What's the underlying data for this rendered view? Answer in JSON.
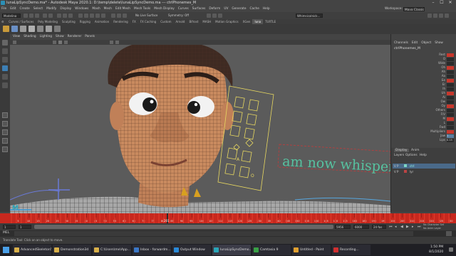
{
  "window": {
    "title": "lunaLipSyncDemo.ma* - Autodesk Maya 2020.1: D:\\temp\\delete\\lunaLipSyncDemo.ma --- ctrlPhonemes_M",
    "controls": [
      "–",
      "☐",
      "✕"
    ]
  },
  "menubar": {
    "items": [
      "File",
      "Edit",
      "Create",
      "Select",
      "Modify",
      "Display",
      "Windows",
      "Mash",
      "Mesh",
      "Edit Mesh",
      "Mesh Tools",
      "Mesh Display",
      "Curves",
      "Surfaces",
      "Deform",
      "UV",
      "Generate",
      "Cache",
      "Help"
    ],
    "workspace_label": "Workspace:",
    "workspace_value": "Maya Classic"
  },
  "statusline": {
    "mode": "Modeling",
    "no_live_surface": "No Live Surface",
    "symmetry": "Symmetry: Off",
    "user": "Whimsicalnick...",
    "sign_in": "v"
  },
  "shelf_tabs": [
    "Curves / Surfaces",
    "Poly Modeling",
    "Sculpting",
    "Rigging",
    "Animation",
    "Rendering",
    "FX",
    "FX Caching",
    "Custom",
    "Arnold",
    "Bifrost",
    "MASH",
    "Motion Graphics",
    "XGen",
    "luna",
    "TURTLE"
  ],
  "shelf_active_tab": "luna",
  "viewport_menu": [
    "View",
    "Shading",
    "Lighting",
    "Show",
    "Renderer",
    "Panels"
  ],
  "viewport": {
    "overlay_text": "am   now   whisper",
    "face_slider_labels": [
      "A",
      "O"
    ]
  },
  "channel_box": {
    "menu": [
      "Channels",
      "Edit",
      "Object",
      "Show"
    ],
    "object_name": "ctrlPhonemes_M",
    "channels": [
      "Rest",
      "O",
      "Wide",
      "Oh",
      "Ah",
      "Aa",
      "Ee",
      "Er",
      "Ih",
      "Uh",
      "Ai",
      "Ow",
      "Oy",
      "Others",
      "F/V",
      "M",
      "L",
      "Fwd",
      "Multipliers",
      "Jaw",
      "Lips"
    ],
    "multiplier_values": [
      "1",
      "0.15"
    ]
  },
  "layer_editor": {
    "menu": [
      "Display",
      "Anim"
    ],
    "submenu": [
      "Layers",
      "Options",
      "Help"
    ],
    "layers": [
      {
        "flags": "V P",
        "name": "ctrl"
      },
      {
        "flags": "V P",
        "name": "lyr"
      }
    ]
  },
  "timeline": {
    "current_frame": "201",
    "tick_labels": [
      "5",
      "10",
      "15",
      "20",
      "25",
      "30",
      "35",
      "40",
      "45",
      "50",
      "55",
      "60",
      "65",
      "70",
      "75",
      "80",
      "85",
      "90",
      "95",
      "100",
      "105",
      "110",
      "115",
      "120",
      "125",
      "130",
      "135",
      "140",
      "145",
      "150",
      "155",
      "160",
      "165",
      "170",
      "175",
      "180",
      "185",
      "190",
      "195",
      "200",
      "205",
      "210",
      "215",
      "220",
      "225",
      "230"
    ]
  },
  "range": {
    "start": "1",
    "anim_start": "1",
    "end": "5956",
    "anim_end": "6000",
    "fps": "24 fps",
    "char_set": "No Character Set",
    "anim_layer": "No Anim Layer"
  },
  "command_line": {
    "label": "MEL"
  },
  "help_line": {
    "text": "Translate Tool: Click on an object to move."
  },
  "taskbar": {
    "items": [
      {
        "label": "AdvancedSkeleton5",
        "color": "#d8b04a"
      },
      {
        "label": "Demonstration3d",
        "color": "#d8b04a"
      },
      {
        "label": "C:\\Users\\me\\App...",
        "color": "#d8b04a"
      },
      {
        "label": "Inbox - forwardm...",
        "color": "#3b78c7"
      },
      {
        "label": "Output Window",
        "color": "#2a8ad8"
      },
      {
        "label": "lunaLipSyncDemo...",
        "color": "#2aa5b8"
      },
      {
        "label": "Camtasia 9",
        "color": "#39a046"
      },
      {
        "label": "Untitled - Paint",
        "color": "#e0a030"
      },
      {
        "label": "Recording...",
        "color": "#d03030"
      }
    ],
    "clock_time": "1:50 PM",
    "clock_date": "8/1/2020"
  },
  "colors": {
    "timeline_red": "#c8281e",
    "skin": "#c98a5f",
    "overlay_green": "#57c2a0",
    "selection_yellow": "#e8d860"
  }
}
